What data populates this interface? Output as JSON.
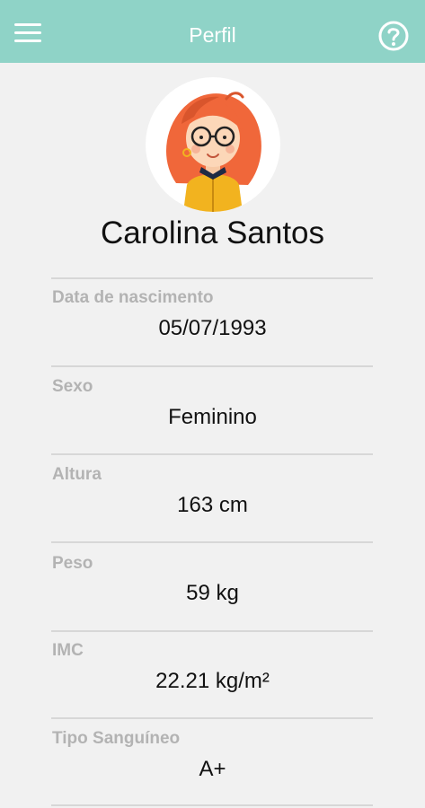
{
  "header": {
    "title": "Perfil",
    "menu_icon": "hamburger-menu-icon",
    "help_icon": "help-circle-icon"
  },
  "profile": {
    "name": "Carolina Santos",
    "avatar_icon": "avatar-illustration"
  },
  "fields": [
    {
      "label": "Data de nascimento",
      "value": "05/07/1993"
    },
    {
      "label": "Sexo",
      "value": "Feminino"
    },
    {
      "label": "Altura",
      "value": "163 cm"
    },
    {
      "label": "Peso",
      "value": "59 kg"
    },
    {
      "label": "IMC",
      "value": "22.21 kg/m²"
    },
    {
      "label": "Tipo Sanguíneo",
      "value": "A+"
    }
  ],
  "colors": {
    "header_bg": "#8fd3c7",
    "page_bg": "#f1f1f1",
    "label_text": "#b3b3b3",
    "value_text": "#111111"
  }
}
